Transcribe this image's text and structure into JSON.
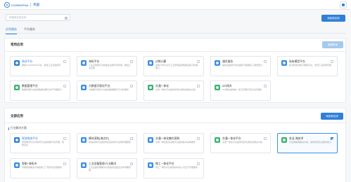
{
  "header": {
    "logo_text": "COSMOPlat",
    "app_name": "天启"
  },
  "search": {
    "placeholder": "请搜索应用名称"
  },
  "top_action": {
    "label": "添加新应用"
  },
  "tabs": [
    {
      "label": "应用服务",
      "active": true
    },
    {
      "label": "平台服务",
      "active": false
    }
  ],
  "common": {
    "title": "常用应用",
    "action": "管理常用",
    "cards": [
      {
        "name": "测试平台",
        "desc": "继续COSMOPlat平台，搭建工业互联网平",
        "color": "#2f7fd8",
        "link": true,
        "checked": false
      },
      {
        "name": "海码平台",
        "desc": "工业互联网平台赋能企业数字化转型，推进工业互联",
        "color": "#3a8ee6",
        "link": false,
        "checked": false
      },
      {
        "name": "边缘计算",
        "desc": "边缘计算平台为工业现场提供数据采集与处理能力",
        "color": "#3a8ee6",
        "link": false,
        "checked": false
      },
      {
        "name": "通讯服务",
        "desc": "提供设备通讯协议解析与数据接入服务能力",
        "color": "#3a8ee6",
        "link": false,
        "checked": false
      },
      {
        "name": "私有模型平台",
        "desc": "私有模型训练与部署平台，支持工业模型管理",
        "color": "#3a8ee6",
        "link": false,
        "checked": false
      },
      {
        "name": "数据管理平台",
        "desc": "数据管理平台提供数据治理与资产管理能力",
        "color": "#3cb371",
        "link": false,
        "checked": false
      },
      {
        "name": "大数据可视化平台",
        "desc": "大数据可视化平台提供数据展示与分析服务",
        "color": "#3a8ee6",
        "link": false,
        "checked": false
      },
      {
        "name": "交通一体化",
        "desc": "交通一体化平台提供智慧交通综合解决方案",
        "color": "#3cb371",
        "link": false,
        "checked": false
      },
      {
        "name": "API网关",
        "desc": "API网关提供统一接口管理与安全访问控制",
        "color": "#3cb371",
        "link": false,
        "checked": false
      }
    ]
  },
  "all": {
    "title": "全部应用",
    "action": "添加新应用",
    "subhead": "行业解决方案",
    "cards": [
      {
        "name": "智慧物流平台",
        "desc": "智慧物流平台为物流行业提供数字化管理，赋能企业",
        "color": "#2f7fd8",
        "link": true,
        "checked": false
      },
      {
        "name": "模块采购(海达尔)",
        "desc": "模块采购平台提供供应链协同与采购管理服务",
        "color": "#3a8ee6",
        "link": false,
        "checked": false
      },
      {
        "name": "交通一体化集约采购",
        "desc": "交通一体化集约采购平台提供集中采购服务",
        "color": "#3a8ee6",
        "link": false,
        "checked": false
      },
      {
        "name": "交通一体化平台",
        "desc": "交通一体化平台提供智慧交通综合解决方案",
        "color": "#3cb371",
        "link": false,
        "checked": false
      },
      {
        "name": "农业-海技术",
        "desc": "农业物联网解决方案，提供智慧农业服务能力",
        "color": "#3cb371",
        "link": false,
        "checked": true
      },
      {
        "name": "智能+海拓市",
        "desc": "智能制造解决方案提供工厂数字化改造服务",
        "color": "#3a8ee6",
        "link": false,
        "checked": false
      },
      {
        "name": "工业设备管理-行业解决",
        "desc": "工业设备管理解决方案提供设备全生命周期管理",
        "color": "#3a8ee6",
        "link": false,
        "checked": false
      },
      {
        "name": "微工一体化平台",
        "desc": "微工一体化平台提供协同办公与生产管理服务",
        "color": "#3a8ee6",
        "link": false,
        "checked": false
      }
    ]
  }
}
